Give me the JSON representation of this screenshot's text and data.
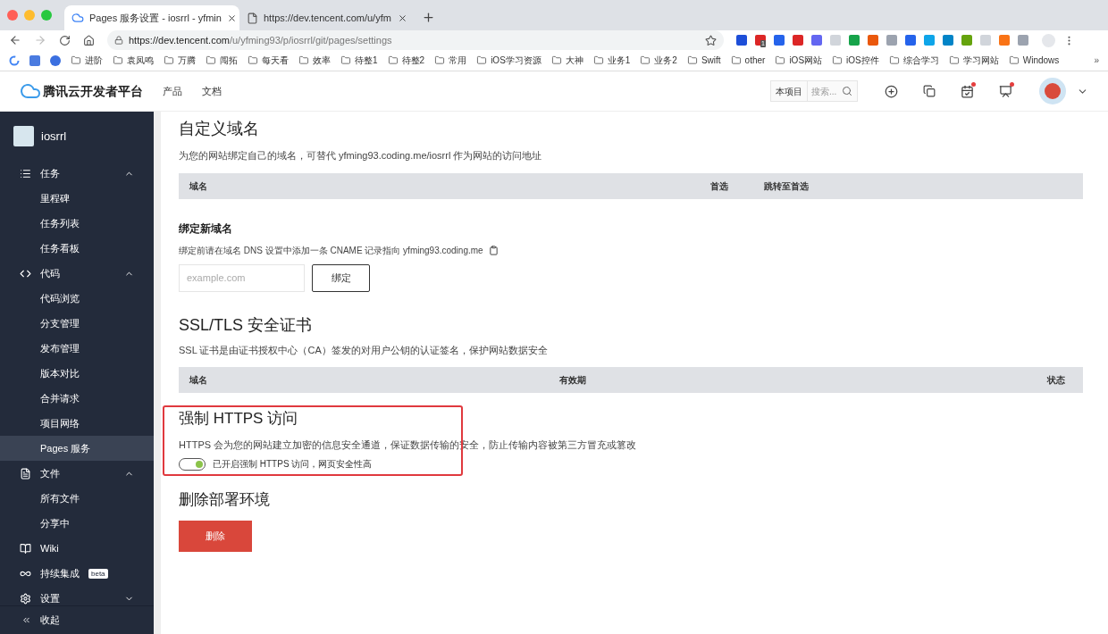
{
  "browser": {
    "tabs": [
      {
        "title": "Pages 服务设置 - iosrrl - yfmin",
        "selected": true,
        "kind": "cloud"
      },
      {
        "title": "https://dev.tencent.com/u/yfm",
        "selected": false,
        "kind": "page"
      }
    ],
    "address": {
      "host": "https://dev.tencent.com",
      "path": "/u/yfming93/p/iosrrl/git/pages/settings"
    },
    "extension_badge": "1",
    "bookmarks": [
      "进阶",
      "袁凤鸣",
      "万腾",
      "闯拓",
      "每天看",
      "效率",
      "待整1",
      "待整2",
      "常用",
      "iOS学习资源",
      "大神",
      "业务1",
      "业务2",
      "Swift",
      "other",
      "iOS网站",
      "iOS控件",
      "综合学习",
      "学习网站",
      "Windows"
    ],
    "bookmarks_more": "»"
  },
  "header": {
    "logo": "腾讯云开发者平台",
    "nav": [
      "产品",
      "文档"
    ],
    "scope": "本项目",
    "search_placeholder": "搜索..."
  },
  "sidebar": {
    "project": "iosrrl",
    "items": [
      {
        "kind": "group",
        "label": "任务",
        "expanded": true,
        "children": [
          {
            "label": "里程碑",
            "selected": false
          },
          {
            "label": "任务列表",
            "selected": false
          },
          {
            "label": "任务看板",
            "selected": false
          }
        ]
      },
      {
        "kind": "group",
        "label": "代码",
        "expanded": true,
        "children": [
          {
            "label": "代码浏览",
            "selected": false
          },
          {
            "label": "分支管理",
            "selected": false
          },
          {
            "label": "发布管理",
            "selected": false
          },
          {
            "label": "版本对比",
            "selected": false
          },
          {
            "label": "合并请求",
            "selected": false
          },
          {
            "label": "项目网络",
            "selected": false
          },
          {
            "label": "Pages 服务",
            "selected": true
          }
        ]
      },
      {
        "kind": "group",
        "label": "文件",
        "expanded": true,
        "children": [
          {
            "label": "所有文件",
            "selected": false
          },
          {
            "label": "分享中",
            "selected": false
          }
        ]
      },
      {
        "kind": "link",
        "label": "Wiki"
      },
      {
        "kind": "link",
        "label": "持续集成",
        "badge": "beta"
      },
      {
        "kind": "group",
        "label": "设置",
        "expanded": false
      }
    ],
    "collapse": "收起"
  },
  "custom_domain": {
    "title": "自定义域名",
    "description": "为您的网站绑定自己的域名，可替代 yfming93.coding.me/iosrrl 作为网站的访问地址",
    "columns": [
      "域名",
      "首选",
      "跳转至首选"
    ]
  },
  "bind_domain": {
    "title": "绑定新域名",
    "hint": "绑定前请在域名 DNS 设置中添加一条 CNAME 记录指向 yfming93.coding.me",
    "placeholder": "example.com",
    "button": "绑定"
  },
  "ssl": {
    "title": "SSL/TLS 安全证书",
    "description": "SSL 证书是由证书授权中心（CA）签发的对用户公钥的认证签名，保护网站数据安全",
    "columns": [
      "域名",
      "有效期",
      "状态"
    ]
  },
  "https": {
    "title": "强制 HTTPS 访问",
    "description": "HTTPS 会为您的网站建立加密的信息安全通道，保证数据传输的安全，防止传输内容被第三方冒充或篡改",
    "toggle": {
      "on": true,
      "label": "已开启强制 HTTPS 访问，网页安全性高"
    }
  },
  "delete_env": {
    "title": "删除部署环境",
    "button": "删除"
  }
}
